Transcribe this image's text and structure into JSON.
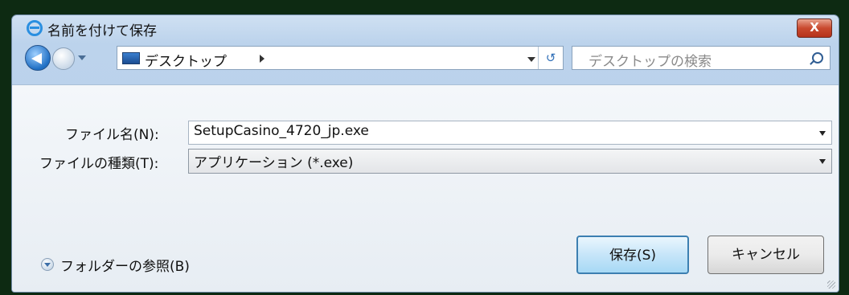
{
  "window": {
    "title": "名前を付けて保存",
    "close_glyph": "X"
  },
  "nav": {
    "address": "デスクトップ",
    "search_placeholder": "デスクトップの検索",
    "refresh_glyph": "↺"
  },
  "form": {
    "filename_label": "ファイル名(N):",
    "filename_value": "SetupCasino_4720_jp.exe",
    "filetype_label": "ファイルの種類(T):",
    "filetype_value": "アプリケーション (*.exe)"
  },
  "footer": {
    "browse_label": "フォルダーの参照(B)",
    "save_label": "保存(S)",
    "cancel_label": "キャンセル"
  },
  "colors": {
    "background": "#0d2a12",
    "accent_blue": "#3c7fb1",
    "close_red": "#c94a2f"
  }
}
